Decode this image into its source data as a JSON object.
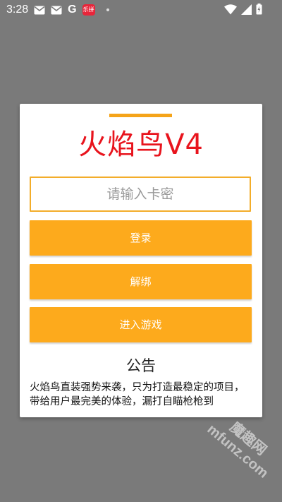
{
  "status_bar": {
    "time": "3:28",
    "left_icons": [
      "mail-icon",
      "mail-icon",
      "google-icon",
      "app-notification-icon",
      "dot-icon"
    ],
    "google_letter": "G",
    "app_badge_text": "乐拼",
    "right_icons": [
      "wifi-icon",
      "signal-icon",
      "battery-icon"
    ]
  },
  "dialog": {
    "title": "火焰鸟V4",
    "key_input": {
      "value": "",
      "placeholder": "请输入卡密"
    },
    "buttons": {
      "login": "登录",
      "unbind": "解绑",
      "enter_game": "进入游戏"
    },
    "notice": {
      "heading": "公告",
      "body": "火焰鸟直装强势来袭，只为打造最稳定的项目，带给用户最完美的体验，漏打自瞄枪枪到"
    }
  },
  "watermark": {
    "line1": "魔趣网",
    "line2": "mfunz.com"
  },
  "colors": {
    "accent_orange": "#fdaa1c",
    "title_red": "#e8141d",
    "backdrop_gray": "#7a7a7a"
  }
}
